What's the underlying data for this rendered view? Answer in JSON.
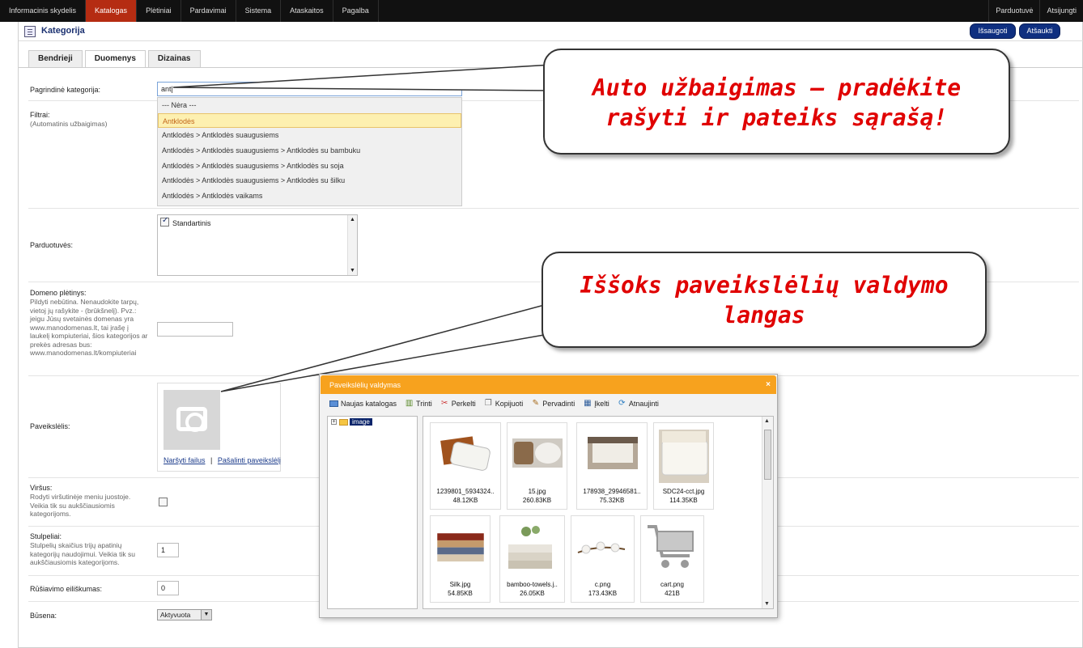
{
  "topnav": {
    "items": [
      "Informacinis skydelis",
      "Katalogas",
      "Plėtiniai",
      "Pardavimai",
      "Sistema",
      "Ataskaitos",
      "Pagalba"
    ],
    "active_index": 1,
    "right_items": [
      "Parduotuvė",
      "Atsijungti"
    ]
  },
  "header": {
    "title": "Kategorija",
    "save_label": "Išsaugoti",
    "cancel_label": "Atšaukti"
  },
  "tabs": [
    "Bendrieji",
    "Duomenys",
    "Dizainas"
  ],
  "form": {
    "parent_label": "Pagrindinė kategorija:",
    "parent_value": "ant|",
    "filters_label": "Filtrai:",
    "filters_help": "(Automatinis užbaigimas)",
    "stores_label": "Parduotuvės:",
    "store_option": "Standartinis",
    "keyword_label": "Domeno plėtinys:",
    "keyword_help": "Pildyti nebūtina. Nenaudokite tarpų, vietoj jų rašykite - (brūkšnelį). Pvz.: jeigu Jūsų svetainės domenas yra www.manodomenas.lt, tai įrašę į laukelį kompiuteriai, šios kategorijos ar prekės adresas bus: www.manodomenas.lt/kompiuteriai",
    "image_label": "Paveikslėlis:",
    "browse_link": "Naršyti failus",
    "link_sep": "|",
    "remove_link": "Pašalinti paveikslėlį",
    "top_label": "Viršus:",
    "top_help": "Rodyti viršutinėje meniu juostoje. Veikia tik su aukščiausiomis kategorijoms.",
    "columns_label": "Stulpeliai:",
    "columns_help": "Stulpelių skaičius trijų apatinių kategorijų naudojimui. Veikia tik su aukščiausiomis kategorijoms.",
    "columns_value": "1",
    "sort_label": "Rūšiavimo eiliškumas:",
    "sort_value": "0",
    "status_label": "Būsena:",
    "status_value": "Aktyvuota"
  },
  "autocomplete": {
    "items": [
      "--- Nėra ---",
      "Antklodės",
      "Antklodės > Antklodės suaugusiems",
      "Antklodės > Antklodės suaugusiems > Antklodės su bambuku",
      "Antklodės > Antklodės suaugusiems > Antklodės su soja",
      "Antklodės > Antklodės suaugusiems > Antklodės su šilku",
      "Antklodės > Antklodės vaikams"
    ],
    "selected_index": 1
  },
  "callouts": {
    "autocomplete": "Auto užbaigimas – pradėkite rašyti ir pateiks sąrašą!",
    "image_manager": "Iššoks paveikslėlių valdymo langas"
  },
  "file_manager": {
    "title": "Paveikslėlių valdymas",
    "close_glyph": "×",
    "toolbar": [
      {
        "label": "Naujas katalogas",
        "icon": "new-folder-icon"
      },
      {
        "label": "Trinti",
        "icon": "trash-icon"
      },
      {
        "label": "Perkelti",
        "icon": "scissors-icon"
      },
      {
        "label": "Kopijuoti",
        "icon": "copy-icon"
      },
      {
        "label": "Pervadinti",
        "icon": "pencil-icon"
      },
      {
        "label": "Įkelti",
        "icon": "upload-icon"
      },
      {
        "label": "Atnaujinti",
        "icon": "refresh-icon"
      }
    ],
    "tree_root": "image",
    "files": [
      {
        "name": "1239801_5934324..",
        "size": "48.12KB"
      },
      {
        "name": "15.jpg",
        "size": "260.83KB"
      },
      {
        "name": "178938_29946581..",
        "size": "75.32KB"
      },
      {
        "name": "SDC24-cct.jpg",
        "size": "114.35KB"
      },
      {
        "name": "Silk.jpg",
        "size": "54.85KB"
      },
      {
        "name": "bamboo-towels.j..",
        "size": "26.05KB"
      },
      {
        "name": "c.png",
        "size": "173.43KB"
      },
      {
        "name": "cart.png",
        "size": "421B"
      }
    ]
  },
  "colors": {
    "topbar": "#111111",
    "active_nav": "#b52c12",
    "button": "#0f2f80",
    "dialog_header": "#f7a21e",
    "callout_text": "#e00000"
  }
}
